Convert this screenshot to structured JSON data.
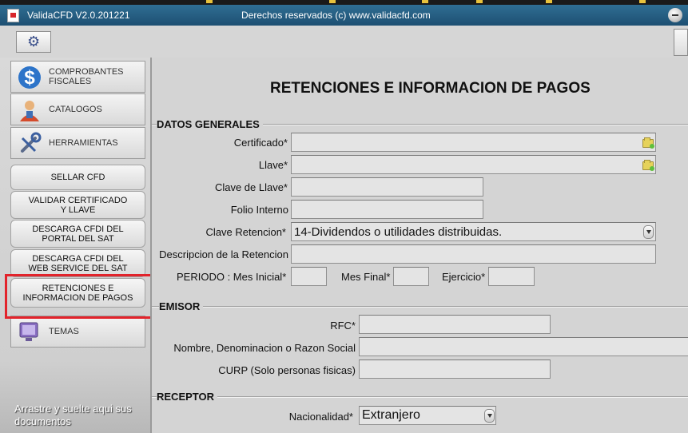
{
  "titlebar": {
    "app_title": "ValidaCFD V2.0.201221",
    "copyright": "Derechos reservados (c) www.validacfd.com"
  },
  "toolbar": {
    "settings_icon": "gear-icon"
  },
  "sidebar": {
    "menu": [
      {
        "label": "COMPROBANTES FISCALES",
        "icon": "dollar-icon"
      },
      {
        "label": "CATALOGOS",
        "icon": "person-icon"
      },
      {
        "label": "HERRAMIENTAS",
        "icon": "tools-icon"
      },
      {
        "label": "TEMAS",
        "icon": "monitor-icon"
      }
    ],
    "submenu": [
      {
        "label": "SELLAR CFD"
      },
      {
        "label": "VALIDAR CERTIFICADO Y LLAVE"
      },
      {
        "label": "DESCARGA CFDI DEL PORTAL DEL SAT"
      },
      {
        "label": "DESCARGA CFDI DEL WEB SERVICE DEL SAT"
      },
      {
        "label": "RETENCIONES E INFORMACION DE PAGOS"
      }
    ],
    "drop_hint": "Arrastre y suelte aqui sus documentos"
  },
  "main": {
    "page_title": "RETENCIONES E INFORMACION DE PAGOS",
    "datos_generales": {
      "section_title": "DATOS GENERALES",
      "certificado_label": "Certificado*",
      "llave_label": "Llave*",
      "clave_llave_label": "Clave de Llave*",
      "folio_label": "Folio Interno",
      "clave_retencion_label": "Clave Retencion*",
      "clave_retencion_value": "14-Dividendos o utilidades distribuidas.",
      "descripcion_label": "Descripcion de la Retencion",
      "periodo_label": "PERIODO : Mes Inicial*",
      "mes_final_label": "Mes Final*",
      "ejercicio_label": "Ejercicio*"
    },
    "emisor": {
      "section_title": "EMISOR",
      "rfc_label": "RFC*",
      "nombre_label": "Nombre, Denominacion o Razon Social",
      "curp_label": "CURP (Solo personas fisicas)"
    },
    "receptor": {
      "section_title": "RECEPTOR",
      "nacionalidad_label": "Nacionalidad*",
      "nacionalidad_value": "Extranjero"
    }
  },
  "colors": {
    "titlebar": "#1d4f72",
    "highlight": "#e2232b",
    "panel": "#d4d4d4"
  }
}
